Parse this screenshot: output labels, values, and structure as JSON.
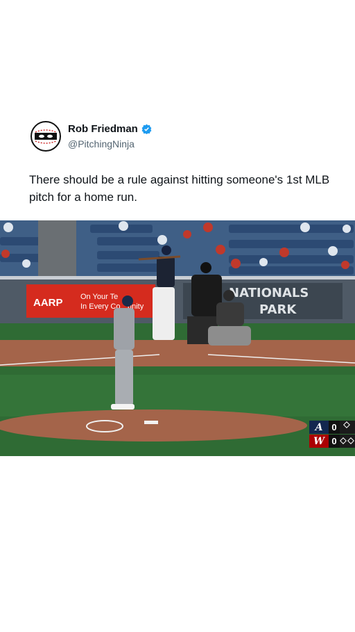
{
  "author": {
    "display_name": "Rob Friedman",
    "handle": "@PitchingNinja",
    "verified": true,
    "avatar_icon": "ninja-baseball-icon"
  },
  "tweet": {
    "text": "There should be a rule against hitting someone's 1st MLB pitch for a home run."
  },
  "media": {
    "stadium_sign": [
      "NATIONALS",
      "PARK"
    ],
    "ad_brand": "AARP",
    "ad_text": [
      "On Your Te",
      "In Every Co",
      "unity"
    ],
    "scorebug": {
      "teams": [
        {
          "logo": "A",
          "score": "0",
          "color": "#13274f"
        },
        {
          "logo": "W",
          "score": "0",
          "color": "#ab0003"
        }
      ]
    }
  },
  "colors": {
    "verified": "#1d9bf0",
    "grass": "#2f6b34",
    "dirt": "#a4644a"
  }
}
